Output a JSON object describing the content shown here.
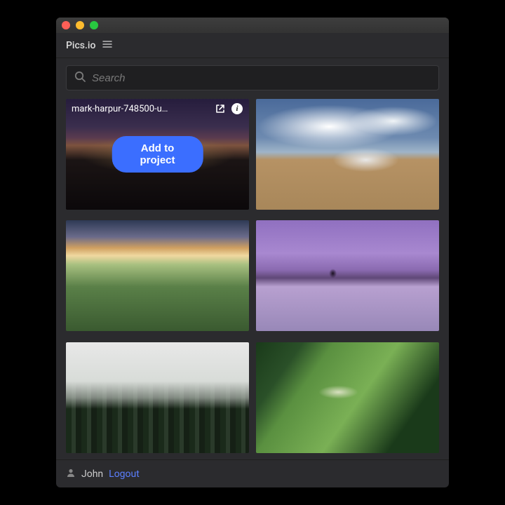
{
  "app": {
    "title": "Pics.io"
  },
  "search": {
    "placeholder": "Search"
  },
  "gallery": {
    "items": [
      {
        "filename": "mark-harpur-748500-u…",
        "selected": true
      },
      {
        "filename": "",
        "selected": false
      },
      {
        "filename": "",
        "selected": false
      },
      {
        "filename": "",
        "selected": false
      },
      {
        "filename": "",
        "selected": false
      },
      {
        "filename": "",
        "selected": false
      }
    ],
    "add_button_label": "Add to project"
  },
  "footer": {
    "username": "John",
    "logout_label": "Logout"
  }
}
